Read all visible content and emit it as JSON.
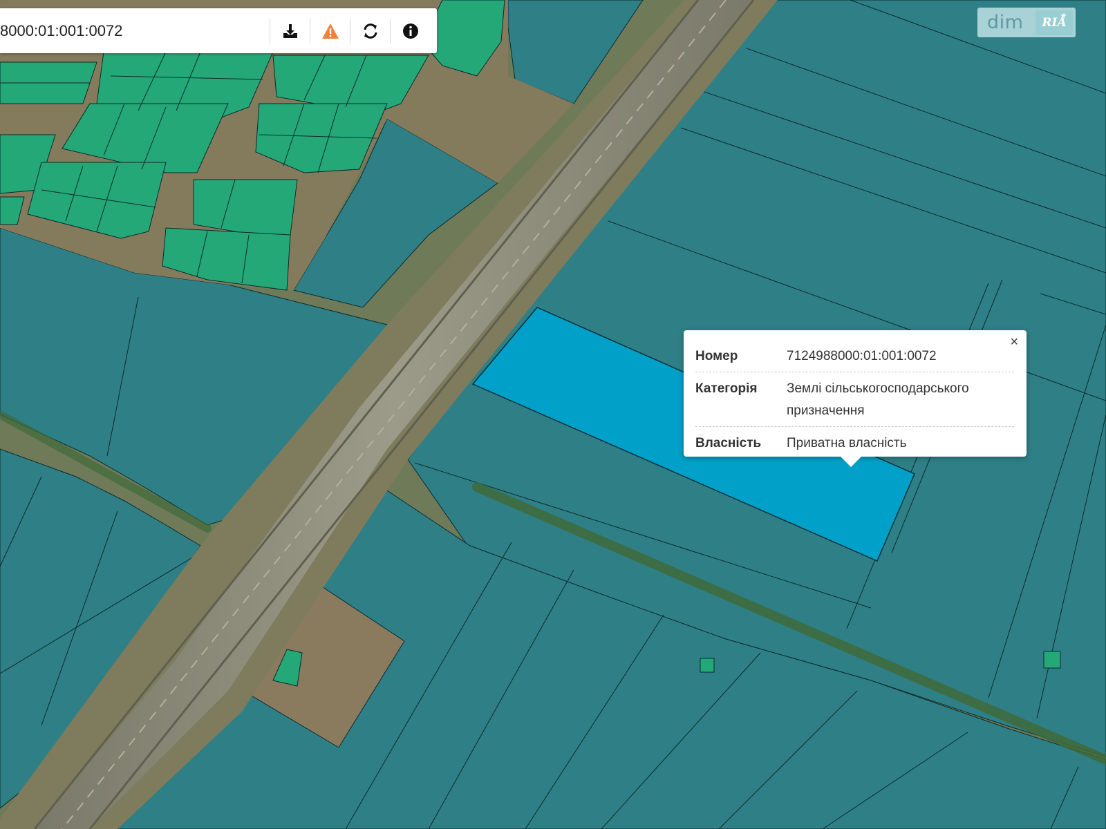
{
  "search": {
    "value": "8000:01:001:0072"
  },
  "toolbar": {
    "buttons": [
      {
        "name": "download-icon",
        "color": "#111111"
      },
      {
        "name": "warning-icon",
        "color": "#f0803c"
      },
      {
        "name": "refresh-icon",
        "color": "#111111"
      },
      {
        "name": "info-icon",
        "color": "#111111"
      }
    ]
  },
  "logo": {
    "part1": "dim",
    "part2": "RIA"
  },
  "popup": {
    "close": "×",
    "rows": [
      {
        "key": "Номер",
        "value": "7124988000:01:001:0072"
      },
      {
        "key": "Категорія",
        "value": "Землі сільськогосподарського призначення"
      },
      {
        "key": "Власність",
        "value": "Приватна власність"
      }
    ]
  },
  "colors": {
    "agri_parcel": "#2f7f86",
    "selected_parcel": "#00a0c8",
    "garden_parcel": "#25a878",
    "road_verge": "#7e7c5c",
    "unassigned_land": "#8a7a5e",
    "warning": "#f0803c"
  }
}
